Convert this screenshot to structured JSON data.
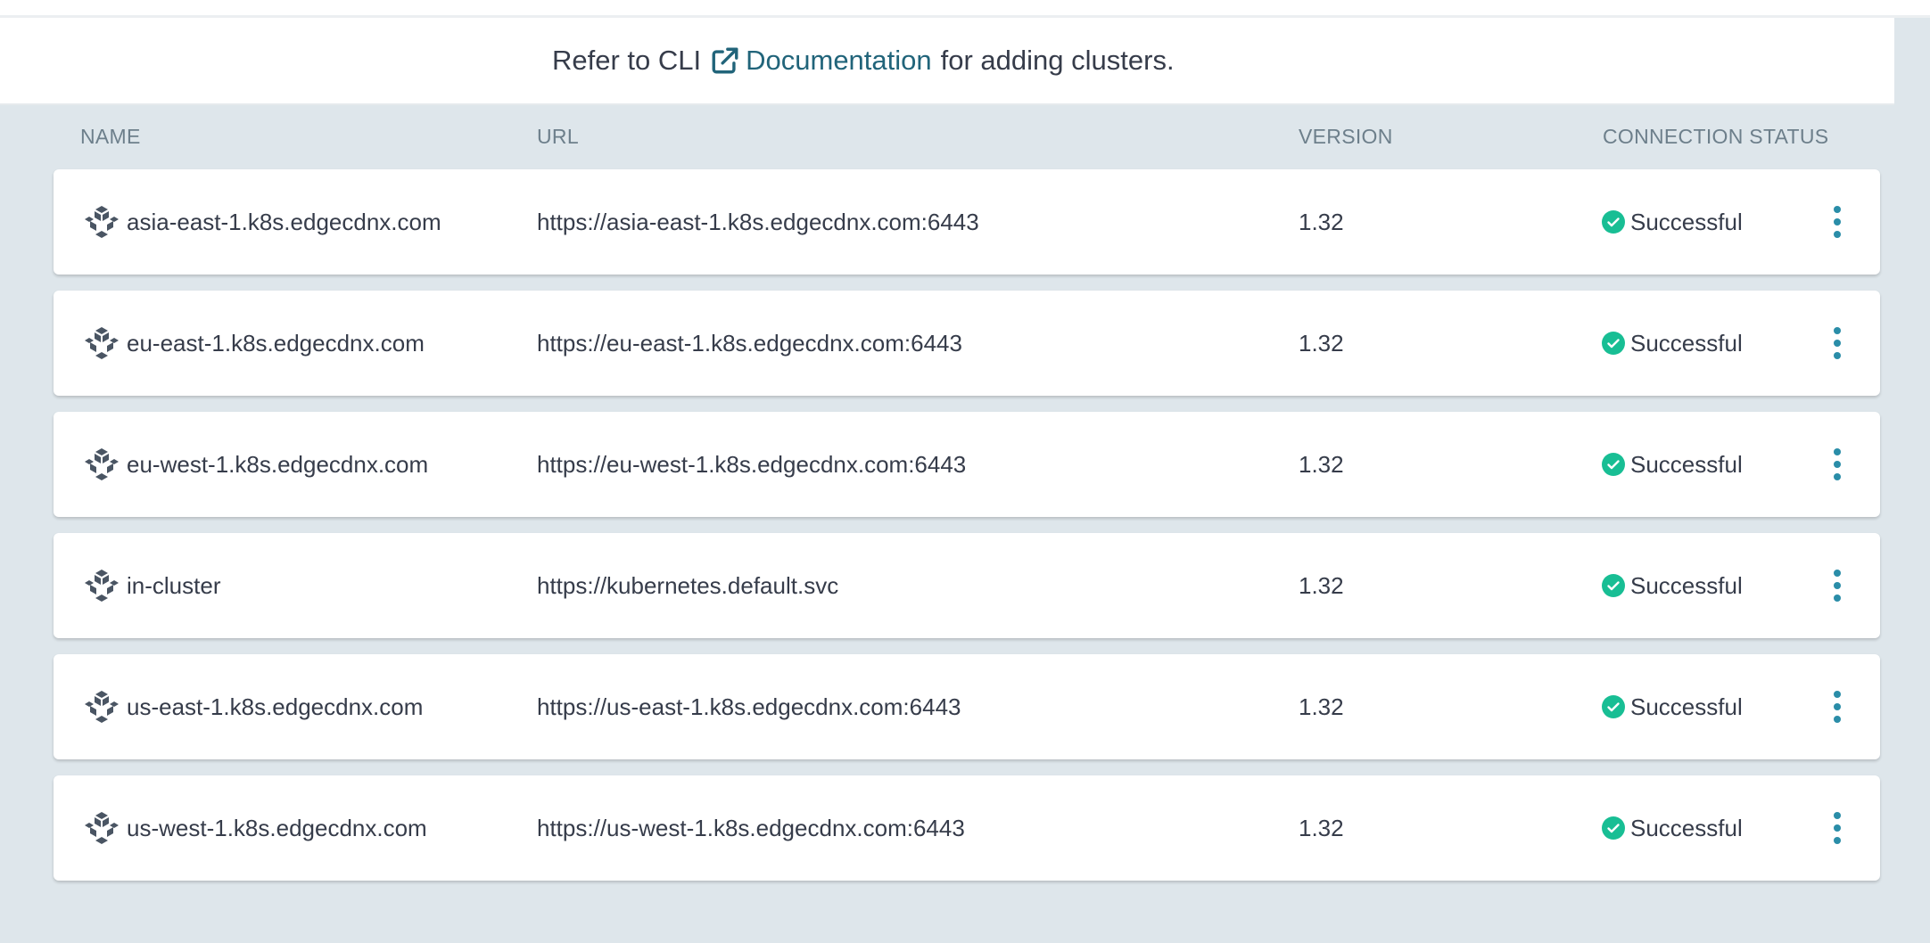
{
  "banner": {
    "prefix": "Refer to CLI",
    "link_label": "Documentation",
    "suffix": "for adding clusters."
  },
  "columns": {
    "name": "NAME",
    "url": "URL",
    "version": "VERSION",
    "status": "CONNECTION STATUS"
  },
  "clusters": [
    {
      "name": "asia-east-1.k8s.edgecdnx.com",
      "url": "https://asia-east-1.k8s.edgecdnx.com:6443",
      "version": "1.32",
      "status": "Successful"
    },
    {
      "name": "eu-east-1.k8s.edgecdnx.com",
      "url": "https://eu-east-1.k8s.edgecdnx.com:6443",
      "version": "1.32",
      "status": "Successful"
    },
    {
      "name": "eu-west-1.k8s.edgecdnx.com",
      "url": "https://eu-west-1.k8s.edgecdnx.com:6443",
      "version": "1.32",
      "status": "Successful"
    },
    {
      "name": "in-cluster",
      "url": "https://kubernetes.default.svc",
      "version": "1.32",
      "status": "Successful"
    },
    {
      "name": "us-east-1.k8s.edgecdnx.com",
      "url": "https://us-east-1.k8s.edgecdnx.com:6443",
      "version": "1.32",
      "status": "Successful"
    },
    {
      "name": "us-west-1.k8s.edgecdnx.com",
      "url": "https://us-west-1.k8s.edgecdnx.com:6443",
      "version": "1.32",
      "status": "Successful"
    }
  ],
  "icons": {
    "cluster": "cluster-cube-icon",
    "status_ok": "check-circle-icon",
    "external_link": "external-link-icon",
    "row_menu": "more-vertical-icon"
  },
  "colors": {
    "link": "#21647a",
    "success": "#18be94",
    "menu": "#2a8da8",
    "background": "#dee6eb"
  }
}
